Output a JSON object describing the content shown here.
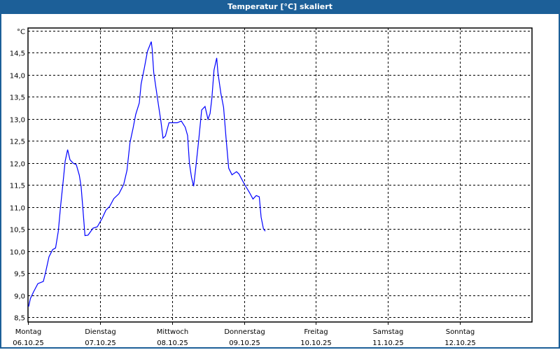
{
  "window": {
    "title": "Temperatur [°C] skaliert"
  },
  "colors": {
    "titlebar": "#1c5f98",
    "line": "#0000ff",
    "grid": "#000000"
  },
  "chart_data": {
    "type": "line",
    "title": "Temperatur [°C] skaliert",
    "ylabel": "°C",
    "xlabel": "",
    "xlim_hours": [
      0,
      168
    ],
    "ylim": [
      8.39,
      15.06
    ],
    "y_ticks": [
      {
        "value": 15.0,
        "label": "°C"
      },
      {
        "value": 14.5,
        "label": "14,5"
      },
      {
        "value": 14.0,
        "label": "14,0"
      },
      {
        "value": 13.5,
        "label": "13,5"
      },
      {
        "value": 13.0,
        "label": "13,0"
      },
      {
        "value": 12.5,
        "label": "12,5"
      },
      {
        "value": 12.0,
        "label": "12,0"
      },
      {
        "value": 11.5,
        "label": "11,5"
      },
      {
        "value": 11.0,
        "label": "11,0"
      },
      {
        "value": 10.5,
        "label": "10,5"
      },
      {
        "value": 10.0,
        "label": "10,0"
      },
      {
        "value": 9.5,
        "label": "9,5"
      },
      {
        "value": 9.0,
        "label": "9,0"
      },
      {
        "value": 8.5,
        "label": "8,5"
      }
    ],
    "x_ticks": [
      {
        "hours": 0,
        "day": "Montag",
        "date": "06.10.25"
      },
      {
        "hours": 24,
        "day": "Dienstag",
        "date": "07.10.25"
      },
      {
        "hours": 48,
        "day": "Mittwoch",
        "date": "08.10.25"
      },
      {
        "hours": 72,
        "day": "Donnerstag",
        "date": "09.10.25"
      },
      {
        "hours": 96,
        "day": "Freitag",
        "date": "10.10.25"
      },
      {
        "hours": 120,
        "day": "Samstag",
        "date": "11.10.25"
      },
      {
        "hours": 144,
        "day": "Sonntag",
        "date": "12.10.25"
      }
    ],
    "grid": true,
    "series": [
      {
        "name": "Temperatur",
        "x_hours": [
          0.2,
          0.8,
          1.9,
          3.3,
          5.1,
          5.8,
          7.0,
          8.2,
          9.2,
          10.1,
          10.9,
          11.7,
          12.4,
          13.2,
          14.0,
          15.1,
          16.1,
          17.1,
          17.7,
          18.2,
          19.0,
          20.0,
          21.7,
          23.1,
          24.7,
          26.0,
          27.2,
          28.6,
          30.3,
          31.9,
          33.0,
          34.0,
          35.0,
          35.9,
          37.1,
          37.7,
          38.8,
          39.8,
          40.4,
          41.1,
          41.4,
          41.9,
          42.7,
          43.5,
          44.3,
          45.0,
          45.8,
          47.0,
          49.7,
          51.1,
          52.4,
          53.2,
          53.8,
          54.5,
          55.2,
          55.9,
          56.9,
          57.9,
          59.0,
          60.0,
          60.7,
          61.3,
          62.0,
          62.9,
          63.3,
          64.3,
          65.2,
          66.0,
          66.9,
          68.0,
          69.5,
          70.3,
          72.2,
          73.8,
          75.0,
          76.1,
          77.1,
          77.7,
          78.5,
          79.1
        ],
        "values": [
          8.74,
          8.92,
          9.08,
          9.26,
          9.31,
          9.5,
          9.87,
          10.03,
          10.07,
          10.45,
          11.04,
          11.56,
          12.04,
          12.3,
          12.07,
          11.99,
          11.96,
          11.72,
          11.46,
          11.04,
          10.35,
          10.36,
          10.52,
          10.55,
          10.74,
          10.93,
          11.01,
          11.19,
          11.3,
          11.51,
          11.83,
          12.46,
          12.78,
          13.1,
          13.36,
          13.79,
          14.16,
          14.53,
          14.63,
          14.75,
          14.58,
          14.05,
          13.68,
          13.31,
          12.94,
          12.56,
          12.61,
          12.91,
          12.91,
          12.95,
          12.81,
          12.62,
          11.99,
          11.67,
          11.47,
          11.88,
          12.52,
          13.2,
          13.28,
          12.99,
          13.12,
          13.47,
          14.1,
          14.38,
          14.05,
          13.57,
          13.26,
          12.57,
          11.88,
          11.73,
          11.8,
          11.75,
          11.51,
          11.33,
          11.18,
          11.26,
          11.23,
          10.77,
          10.5,
          10.45
        ]
      }
    ]
  }
}
